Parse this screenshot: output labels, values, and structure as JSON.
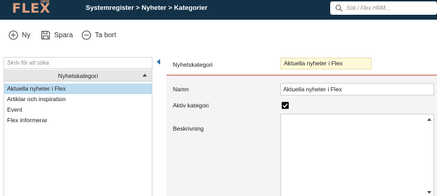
{
  "app": {
    "logo_text": "FLEX",
    "logo_sup": "HRM",
    "breadcrumb": "Systemregister > Nyheter > Kategorier",
    "search_placeholder": "Sök i Flex HRM...",
    "colors": {
      "topbar": "#133247",
      "logo": "#e0a182",
      "selection": "#bcdcf0",
      "divider": "#dd9d94",
      "highlight_field": "#fdf8d8"
    }
  },
  "toolbar": {
    "new_label": "Ny",
    "save_label": "Spara",
    "delete_label": "Ta bort",
    "icons": {
      "new": "plus-circle-icon",
      "save": "floppy-disk-icon",
      "delete": "minus-circle-icon"
    }
  },
  "list": {
    "filter_placeholder": "Skriv för att söka",
    "column_header": "Nyhetskategori",
    "selected_index": 0,
    "items": [
      "Aktuella nyheter i Flex",
      "Artiklar och inspiration",
      "Event",
      "Flex informerar"
    ]
  },
  "detail": {
    "category_label": "Nyhetskategori",
    "category_value": "Aktuella nyheter i Flex",
    "name_label": "Namn",
    "name_value": "Aktuella nyheter i Flex",
    "active_label": "Aktiv kategori",
    "active_checked": true,
    "description_label": "Beskrivning",
    "description_value": ""
  }
}
